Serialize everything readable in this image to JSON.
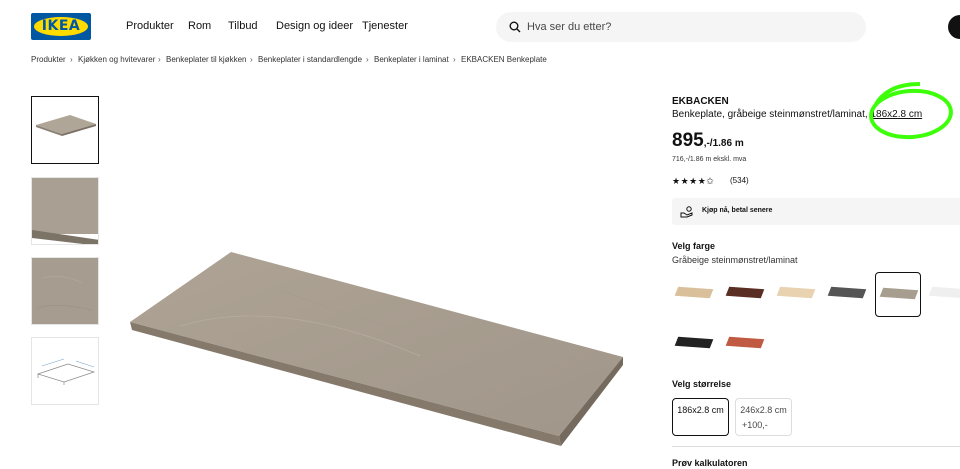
{
  "header": {
    "logo_text": "IKEA",
    "nav": [
      "Produkter",
      "Rom",
      "Tilbud",
      "Design og ideer",
      "Tjenester"
    ],
    "search_placeholder": "Hva ser du etter?"
  },
  "breadcrumb": [
    "Produkter",
    "Kjøkken og hvitevarer",
    "Benkeplater til kjøkken",
    "Benkeplater i standardlengde",
    "Benkeplater i laminat",
    "EKBACKEN Benkeplate"
  ],
  "breadcrumb_separator": "›",
  "product": {
    "name": "EKBACKEN",
    "description": "Benkeplate, gråbeige steinmønstret/laminat,",
    "dimensions": "186x2.8 cm",
    "price_main": "895",
    "price_suffix": ",-/1.86 m",
    "price_ex_vat": "716,-/1.86 m ekskl. mva",
    "rating_stars": "★★★★✩",
    "rating_value": 4.5,
    "review_count": "(534)"
  },
  "financing": {
    "label": "Kjøp nå, betal senere",
    "icon": "hand-coin-icon"
  },
  "color_section": {
    "title": "Velg farge",
    "selected_label": "Gråbeige steinmønstret/laminat",
    "swatches": [
      {
        "name": "light-oak",
        "color": "#d9c09a",
        "selected": false
      },
      {
        "name": "dark-brown",
        "color": "#5a2e22",
        "selected": false
      },
      {
        "name": "light-wood",
        "color": "#e8d2b0",
        "selected": false
      },
      {
        "name": "dark-grey",
        "color": "#555555",
        "selected": false
      },
      {
        "name": "grey-beige-stone",
        "color": "#a89e90",
        "selected": true
      },
      {
        "name": "white-marble",
        "color": "#efefef",
        "selected": false
      },
      {
        "name": "black",
        "color": "#222222",
        "selected": false
      },
      {
        "name": "terracotta",
        "color": "#c05a42",
        "selected": false
      }
    ]
  },
  "size_section": {
    "title": "Velg størrelse",
    "options": [
      {
        "label": "186x2.8 cm",
        "extra": "",
        "selected": true
      },
      {
        "label": "246x2.8 cm",
        "extra": "+100,-",
        "selected": false
      }
    ]
  },
  "calculator": {
    "label": "Prøv kalkulatoren"
  },
  "colors": {
    "accent": "#0058a3",
    "brand_yellow": "#ffdb00",
    "highlight": "#3dff0a",
    "worktop": "#a59a8c"
  }
}
